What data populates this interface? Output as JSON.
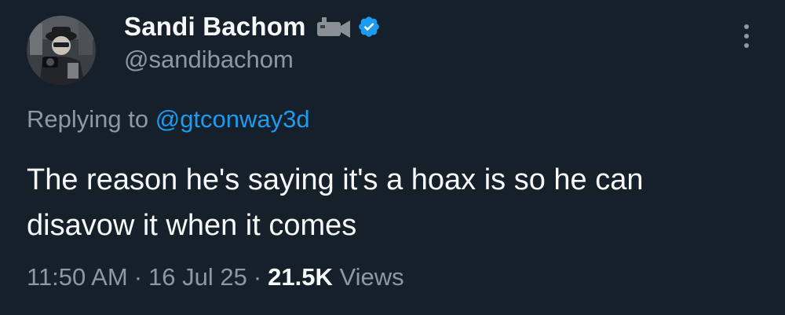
{
  "author": {
    "display_name": "Sandi Bachom",
    "handle": "@sandibachom",
    "badges": [
      "video-camera-icon",
      "verified-badge-icon"
    ],
    "avatar": "avatar-photo"
  },
  "reply": {
    "prefix": "Replying to ",
    "mention": "@gtconway3d"
  },
  "tweet": {
    "text": "The reason he's saying it's a hoax is so he can disavow it when it comes"
  },
  "meta": {
    "time": "11:50 AM",
    "separator": "·",
    "date": "16 Jul 25",
    "views_count": "21.5K",
    "views_label": "Views"
  },
  "more_menu": {
    "icon": "more-vertical-icon"
  },
  "colors": {
    "background": "#15202b",
    "primary_text": "#f7f9f9",
    "secondary_text": "#8b98a5",
    "accent": "#1d9bf0"
  }
}
